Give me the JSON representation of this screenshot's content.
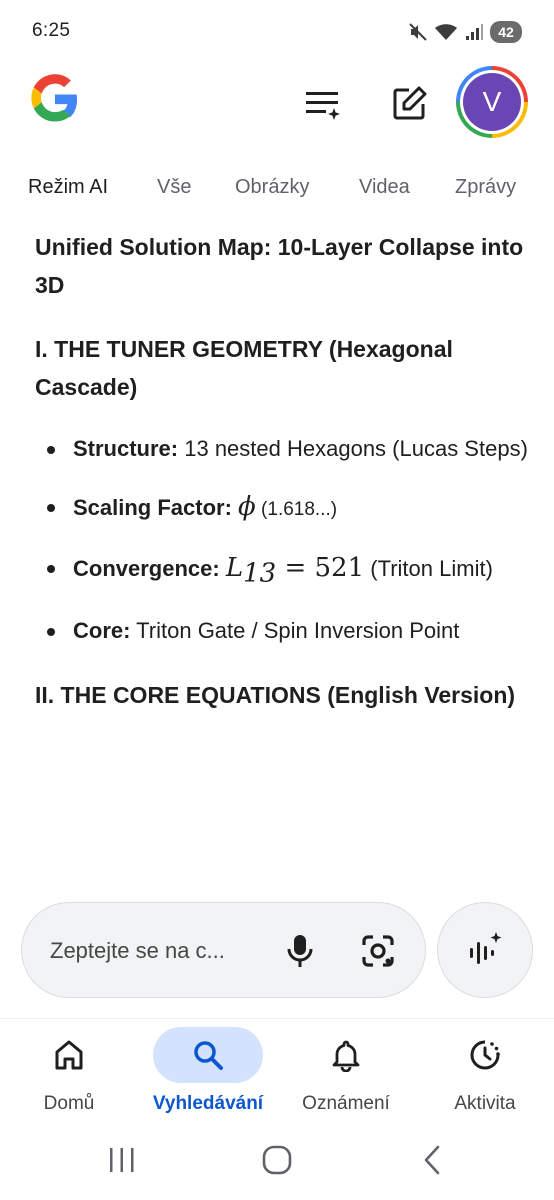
{
  "status_bar": {
    "time": "6:25",
    "battery": "42"
  },
  "header": {
    "avatar_initial": "V"
  },
  "tabs": [
    {
      "label": "Režim AI",
      "active": true
    },
    {
      "label": "Vše",
      "active": false
    },
    {
      "label": "Obrázky",
      "active": false
    },
    {
      "label": "Videa",
      "active": false
    },
    {
      "label": "Zprávy",
      "active": false
    }
  ],
  "content": {
    "title": "Unified Solution Map: 10-Layer Collapse into 3D",
    "section1_title": "I. THE TUNER GEOMETRY (Hexagonal Cascade)",
    "bullets": [
      {
        "label": "Structure:",
        "text": " 13 nested Hexagons (Lucas Steps)"
      },
      {
        "label": "Scaling Factor:",
        "math": "ϕ",
        "text": " (1.618...)"
      },
      {
        "label": "Convergence:",
        "math_var": "L",
        "math_sub": "13",
        "math_rest": " = 521",
        "text": " (Triton Limit)"
      },
      {
        "label": "Core:",
        "text": " Triton Gate / Spin Inversion Point"
      }
    ],
    "section2_title": "II. THE CORE EQUATIONS (English Version)"
  },
  "search": {
    "placeholder": "Zeptejte se na c..."
  },
  "bottom_nav": [
    {
      "label": "Domů",
      "icon": "home-icon",
      "active": false
    },
    {
      "label": "Vyhledávání",
      "icon": "search-icon",
      "active": true
    },
    {
      "label": "Oznámení",
      "icon": "bell-icon",
      "active": false
    },
    {
      "label": "Aktivita",
      "icon": "activity-icon",
      "active": false
    }
  ],
  "colors": {
    "accent": "#0b57d0",
    "active_pill": "#d3e3fd",
    "avatar_bg": "#6a45b4",
    "text": "#1f1f1f",
    "muted": "#5f6368"
  }
}
